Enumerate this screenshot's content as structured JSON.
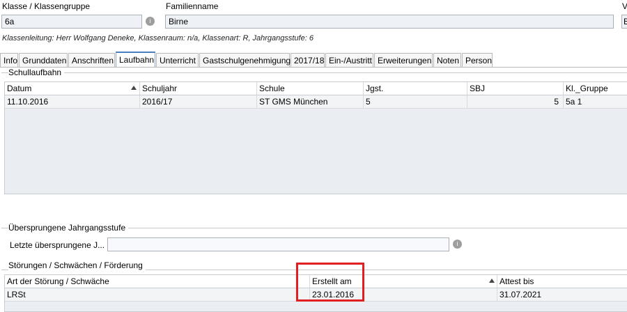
{
  "header": {
    "klasse_label": "Klasse / Klassengruppe",
    "klasse_value": "6a",
    "familienname_label": "Familienname",
    "familienname_value": "Birne",
    "cut_label": "V",
    "cut_value": "E",
    "info_text": "Klassenleitung: Herr Wolfgang Deneke, Klassenraum: n/a, Klassenart: R, Jahrgangsstufe: 6"
  },
  "tabs": [
    {
      "label": "Info"
    },
    {
      "label": "Grunddaten"
    },
    {
      "label": "Anschriften"
    },
    {
      "label": "Laufbahn",
      "active": true
    },
    {
      "label": "Unterricht"
    },
    {
      "label": "Gastschulgenehmigung"
    },
    {
      "label": "2017/18"
    },
    {
      "label": "Ein-/Austritt"
    },
    {
      "label": "Erweiterungen"
    },
    {
      "label": "Noten"
    },
    {
      "label": "Person"
    }
  ],
  "schullaufbahn": {
    "title": "Schullaufbahn",
    "columns": [
      "Datum",
      "Schuljahr",
      "Schule",
      "Jgst.",
      "SBJ",
      "Kl._Gruppe"
    ],
    "rows": [
      [
        "11.10.2016",
        "2016/17",
        "ST GMS München",
        "5",
        "5",
        "5a 1"
      ]
    ]
  },
  "uebersprungen": {
    "title": "Übersprungene Jahrgangsstufe",
    "field_label": "Letzte übersprungene J...",
    "field_value": ""
  },
  "stoerungen": {
    "title": "Störungen / Schwächen / Förderung",
    "columns": [
      "Art der Störung / Schwäche",
      "Erstellt am",
      "Attest bis"
    ],
    "rows": [
      [
        "LRSt",
        "23.01.2016",
        "31.07.2021"
      ]
    ]
  },
  "info_icon": "info-dot-icon",
  "sort_icon": "sort-ascending-icon",
  "highlight_color": "#e02020"
}
